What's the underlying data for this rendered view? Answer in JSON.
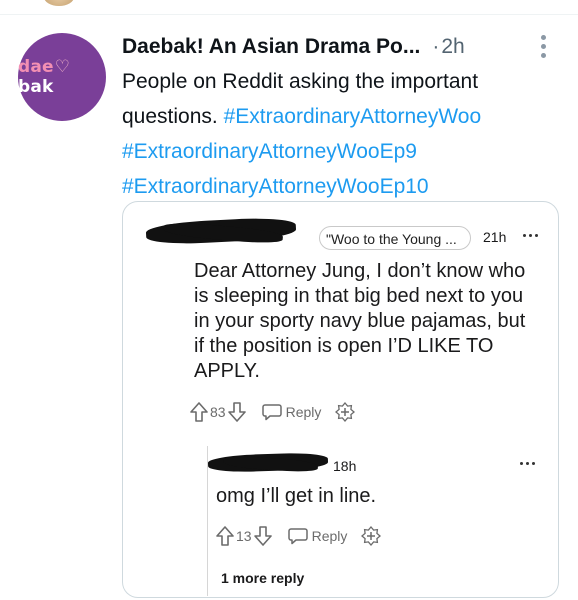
{
  "tweet": {
    "author": "Daebak! An Asian Drama Po...",
    "separator": "·",
    "time": "2h",
    "avatar": {
      "text_left": "dae",
      "text_heart": "♡",
      "text_right": "bak",
      "bg_color": "#7a3f98"
    },
    "text": "People on Reddit asking the important questions.",
    "hashtags": [
      "#ExtraordinaryAttorneyWoo",
      "#ExtraordinaryAttorneyWooEp9",
      "#ExtraordinaryAttorneyWooEp10"
    ],
    "hashtag_color": "#1d9bf0",
    "more_icon": "more-vertical-icon"
  },
  "reddit": {
    "comment": {
      "flair": "\"Woo to the Young ...",
      "time": "21h",
      "text": "Dear Attorney Jung, I don’t know who is sleeping in that big bed next to you in your sporty navy blue pajamas, but if the position is open I’D LIKE TO APPLY.",
      "score": "83",
      "reply_label": "Reply"
    },
    "reply": {
      "time": "18h",
      "text": "omg I’ll get in line.",
      "score": "13",
      "reply_label": "Reply"
    },
    "more_replies": "1 more reply"
  }
}
